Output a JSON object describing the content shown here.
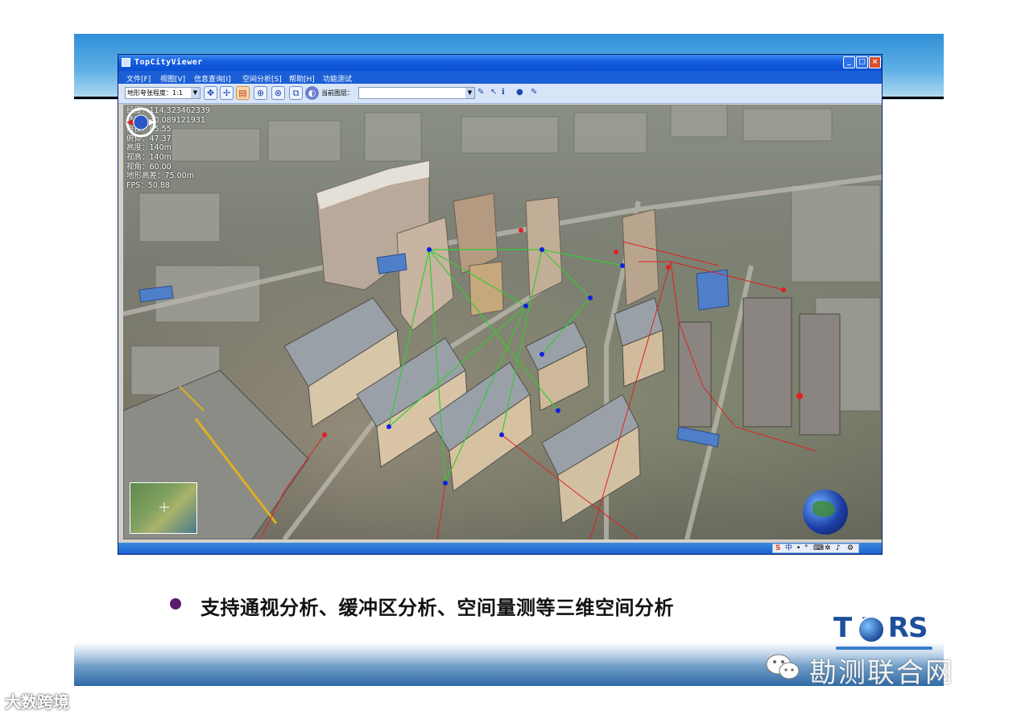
{
  "window": {
    "title": "TopCityViewer",
    "controls": {
      "minimize": "_",
      "maximize": "□",
      "close": "×"
    }
  },
  "menu": [
    "文件[F]",
    "视图[V]",
    "信息查询[I]",
    "空间分析[S]",
    "帮助[H]",
    "功能测试"
  ],
  "toolbar": {
    "scale_select_value": "地形夸张程度：1:1",
    "layer_label": "当前图层：",
    "layer_select_value": "",
    "icons": [
      "fly-to-icon",
      "pan-icon",
      "document-icon",
      "crosshair-icon",
      "zoom-icon",
      "layer-icon",
      "measure-icon"
    ]
  },
  "readout": {
    "lines": [
      "经度：114.323462339",
      "纬度：30.089121931",
      "海拔：65.55",
      "俯仰：47.37",
      "高度：140m",
      "视高：140m",
      "视角：60.00",
      "地形高差：75.00m",
      "FPS：50.88"
    ]
  },
  "tray": {
    "items": [
      "S",
      "中",
      "•",
      "°",
      "⌨",
      "✲",
      "♪",
      "⚙"
    ]
  },
  "caption": "支持通视分析、缓冲区分析、空间量测等三维空间分析",
  "logo": {
    "text": "T  P RS"
  },
  "watermark": {
    "right_text": "勘测联合网",
    "corner_text": "大数跨境"
  },
  "colors": {
    "title_blue": "#0a4fd4",
    "bullet_purple": "#5b1b6b",
    "logo_blue": "#1d4f9a",
    "analysis_red": "#e02020",
    "analysis_green": "#33cc33",
    "analysis_blue": "#1020e0"
  }
}
